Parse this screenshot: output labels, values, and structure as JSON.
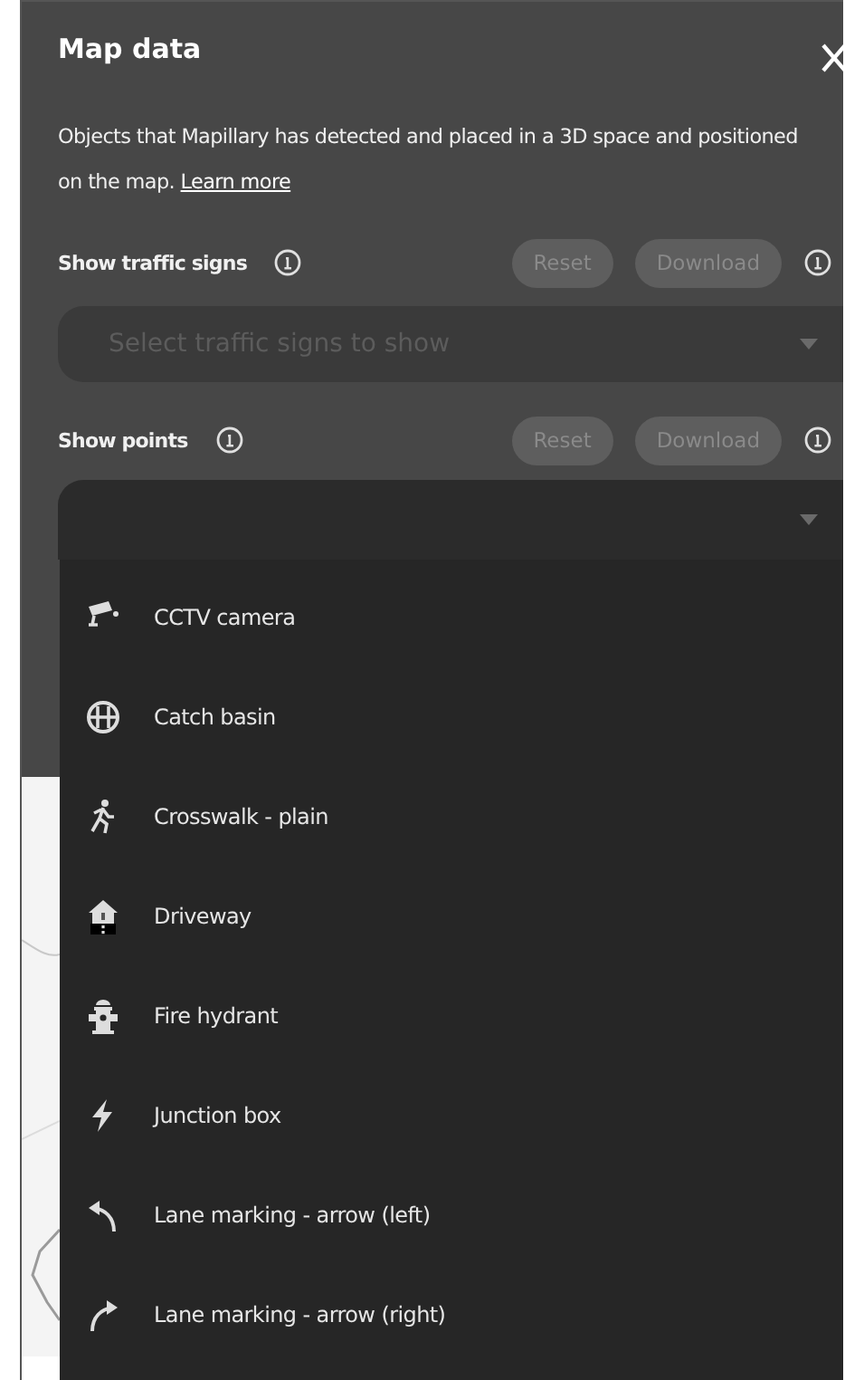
{
  "panel": {
    "title": "Map data",
    "description": "Objects that Mapillary has detected and placed in a 3D space and positioned on the map.",
    "learn_more": "Learn more"
  },
  "sections": [
    {
      "label": "Show traffic signs",
      "reset": "Reset",
      "download": "Download",
      "placeholder": "Select traffic signs to show",
      "expanded": false
    },
    {
      "label": "Show points",
      "reset": "Reset",
      "download": "Download",
      "expanded": true
    }
  ],
  "points": [
    {
      "kind": "camera",
      "label": "CCTV camera"
    },
    {
      "kind": "basin",
      "label": "Catch basin"
    },
    {
      "kind": "walker",
      "label": "Crosswalk - plain"
    },
    {
      "kind": "house",
      "label": "Driveway"
    },
    {
      "kind": "hydrant",
      "label": "Fire hydrant"
    },
    {
      "kind": "bolt",
      "label": "Junction box"
    },
    {
      "kind": "left",
      "label": "Lane marking - arrow (left)"
    },
    {
      "kind": "right",
      "label": "Lane marking - arrow (right)"
    }
  ]
}
